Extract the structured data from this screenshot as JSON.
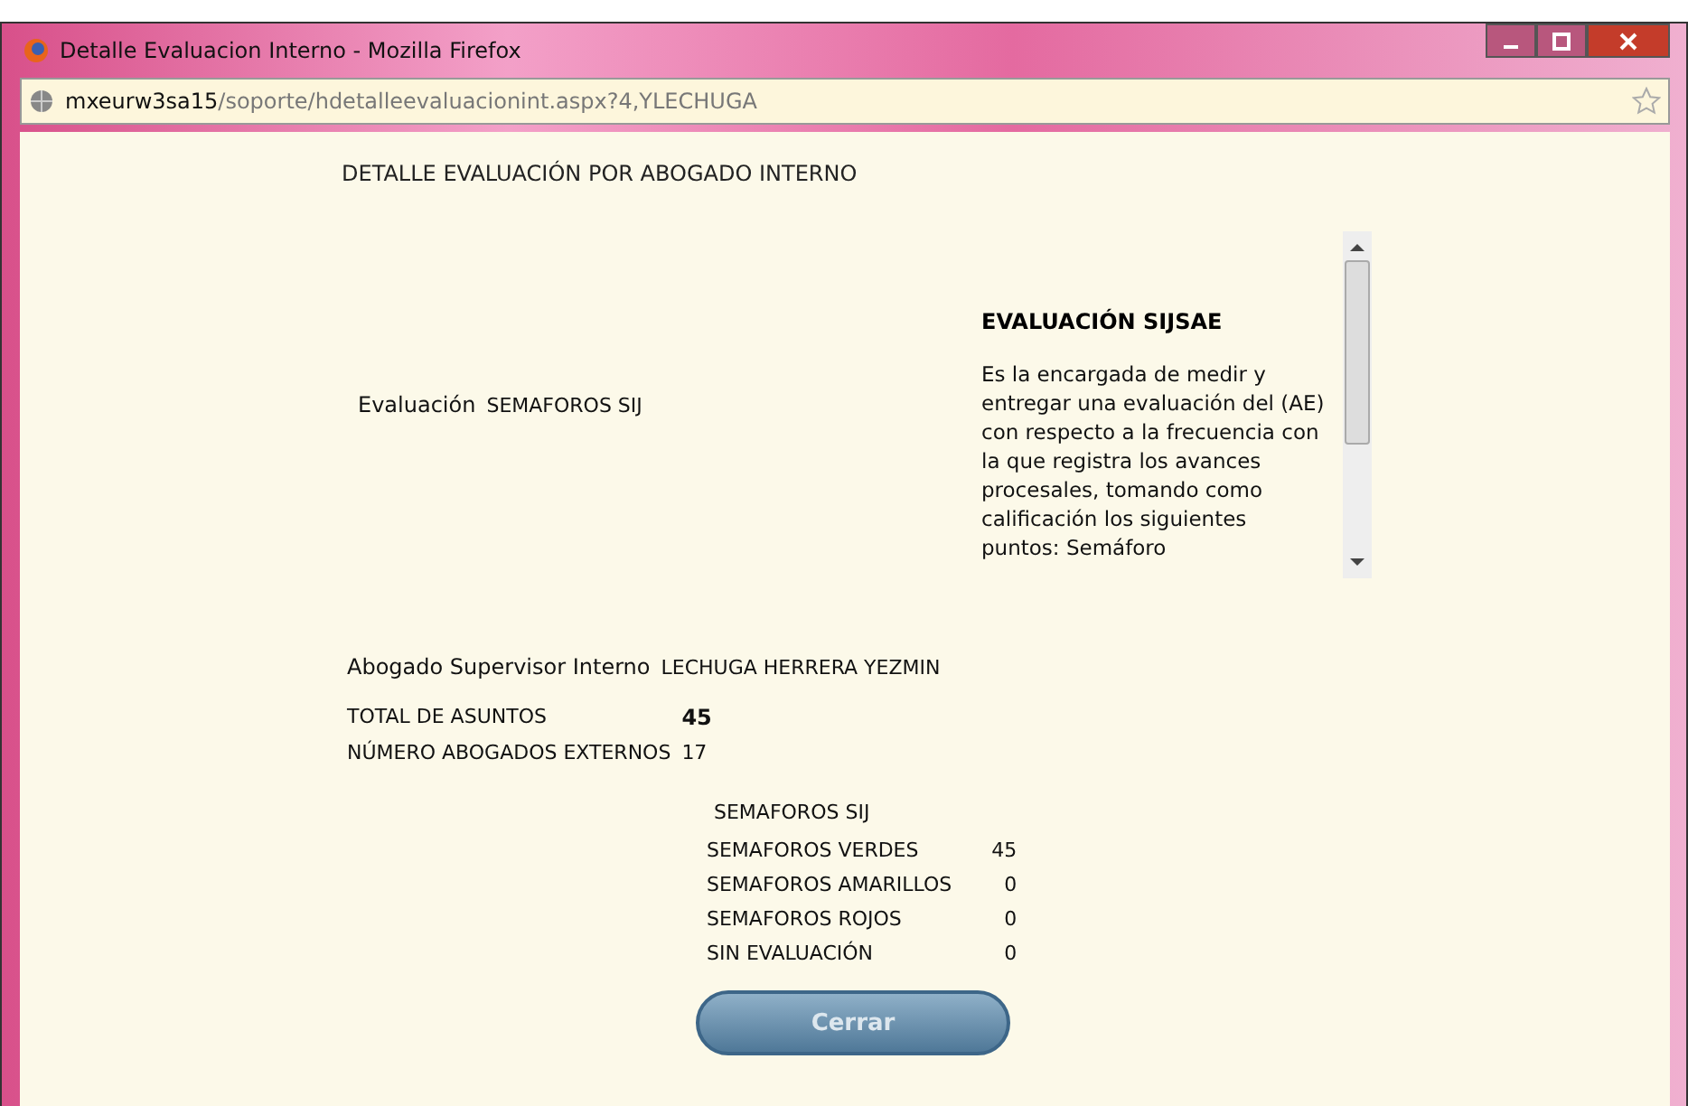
{
  "window": {
    "title": "Detalle Evaluacion Interno - Mozilla Firefox"
  },
  "address_bar": {
    "host": "mxeurw3sa15",
    "path": "/soporte/hdetalleevaluacionint.aspx?4,YLECHUGA"
  },
  "page": {
    "heading": "DETALLE EVALUACIÓN POR ABOGADO INTERNO",
    "evaluation": {
      "label": "Evaluación",
      "value": "SEMAFOROS SIJ"
    },
    "info_panel": {
      "title": "EVALUACIÓN SIJSAE",
      "text": "Es la encargada de medir y entregar una evaluación del (AE) con respecto a la frecuencia con la que registra los avances procesales, tomando como calificación los siguientes puntos: Semáforo"
    },
    "supervisor": {
      "label": "Abogado Supervisor Interno",
      "value": "LECHUGA HERRERA YEZMIN"
    },
    "totals": [
      {
        "label": "TOTAL DE ASUNTOS",
        "value": "45",
        "bold": true
      },
      {
        "label": "NÚMERO ABOGADOS EXTERNOS",
        "value": "17",
        "bold": false
      }
    ],
    "semaforos": {
      "title": "SEMAFOROS SIJ",
      "rows": [
        {
          "label": "SEMAFOROS VERDES",
          "value": "45"
        },
        {
          "label": "SEMAFOROS AMARILLOS",
          "value": "0"
        },
        {
          "label": "SEMAFOROS ROJOS",
          "value": "0"
        },
        {
          "label": "SIN EVALUACIÓN",
          "value": "0"
        }
      ]
    },
    "close_button": "Cerrar"
  }
}
